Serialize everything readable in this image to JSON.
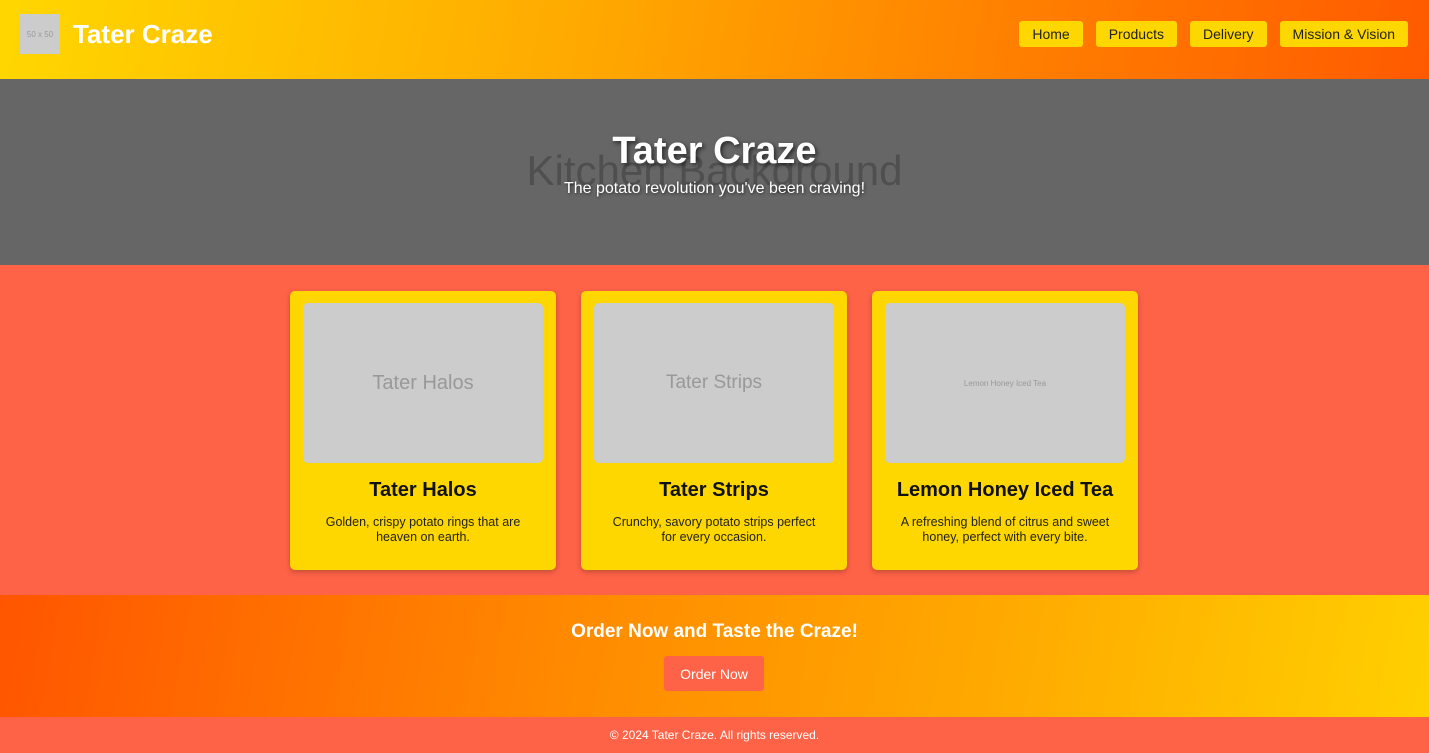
{
  "header": {
    "logo_placeholder": "50 x 50",
    "brand": "Tater Craze",
    "nav": [
      "Home",
      "Products",
      "Delivery",
      "Mission & Vision"
    ]
  },
  "hero": {
    "background_text": "Kitchen Background",
    "title": "Tater Craze",
    "subtitle": "The potato revolution you've been craving!"
  },
  "products": [
    {
      "image_text": "Tater Halos",
      "title": "Tater Halos",
      "description": "Golden, crispy potato rings that are heaven on earth."
    },
    {
      "image_text": "Tater Strips",
      "title": "Tater Strips",
      "description": "Crunchy, savory potato strips perfect for every occasion."
    },
    {
      "image_text": "Lemon Honey Iced Tea",
      "title": "Lemon Honey Iced Tea",
      "description": "A refreshing blend of citrus and sweet honey, perfect with every bite."
    }
  ],
  "cta": {
    "title": "Order Now and Taste the Craze!",
    "button": "Order Now"
  },
  "footer": {
    "text": "© 2024 Tater Craze. All rights reserved."
  },
  "colors": {
    "accent_yellow": "#ffd700",
    "tomato": "#ff6347",
    "hero_gray": "#666666",
    "placeholder_gray": "#cccccc"
  }
}
